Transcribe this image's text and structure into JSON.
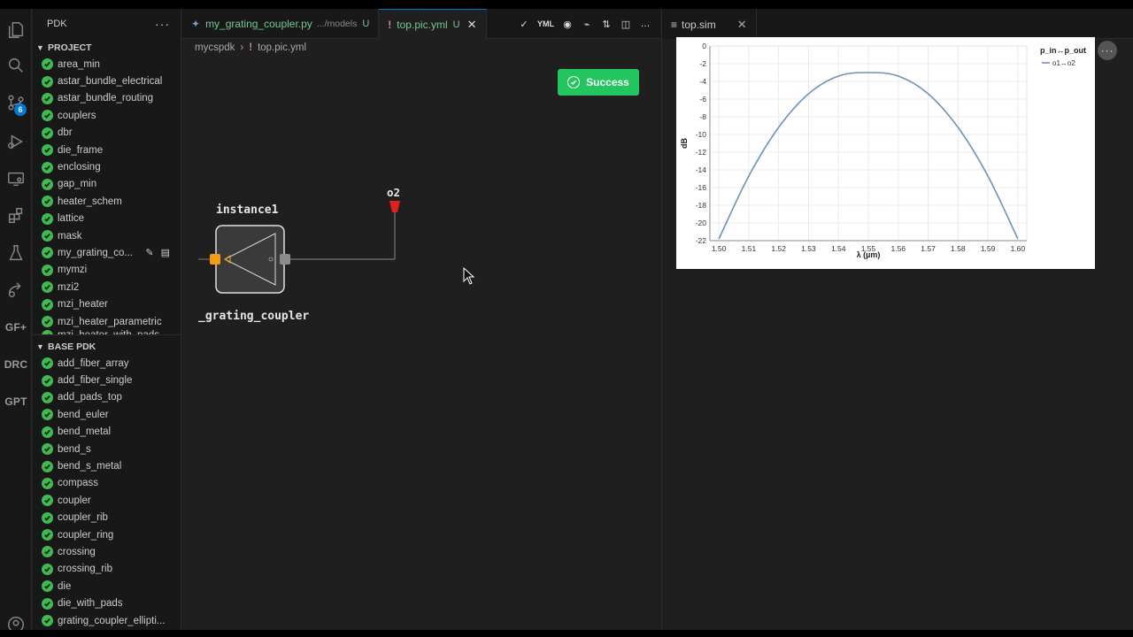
{
  "activity_bar": {
    "source_control_badge": "6",
    "gf_label": "GF+",
    "drc_label": "DRC",
    "gpt_label": "GPT"
  },
  "sidebar": {
    "title": "PDK",
    "project": {
      "title": "PROJECT",
      "items": [
        "area_min",
        "astar_bundle_electrical",
        "astar_bundle_routing",
        "couplers",
        "dbr",
        "die_frame",
        "enclosing",
        "gap_min",
        "heater_schem",
        "lattice",
        "mask",
        "my_grating_co...",
        "mymzi",
        "mzi2",
        "mzi_heater",
        "mzi_heater_parametric",
        "mzi_heater_with_pads"
      ]
    },
    "base_pdk": {
      "title": "BASE PDK",
      "items": [
        "add_fiber_array",
        "add_fiber_single",
        "add_pads_top",
        "bend_euler",
        "bend_metal",
        "bend_s",
        "bend_s_metal",
        "compass",
        "coupler",
        "coupler_rib",
        "coupler_ring",
        "crossing",
        "crossing_rib",
        "die",
        "die_with_pads",
        "grating_coupler_ellipti..."
      ]
    }
  },
  "editor1": {
    "tabs": [
      {
        "label": "my_grating_coupler.py",
        "path": ".../models",
        "status": "U"
      },
      {
        "label": "top.pic.yml",
        "status": "U"
      }
    ],
    "actions": [
      "✓",
      "YML",
      "◉",
      "⌁",
      "⇅",
      "◫",
      "…"
    ],
    "breadcrumb": [
      "mycspdk",
      "top.pic.yml"
    ],
    "success_label": "Success",
    "schematic": {
      "instance_label": "instance1",
      "component_label": "_grating_coupler",
      "port_label": "o2"
    }
  },
  "editor2": {
    "tab": "top.sim"
  },
  "colors": {
    "accent": "#0078d4",
    "success": "#22c55e",
    "check": "#3fb950",
    "curve": "#6f93b8"
  },
  "chart_data": {
    "type": "line",
    "xlabel": "λ (µm)",
    "ylabel": "dB",
    "legend_title": "p_in↔p_out",
    "legend_position": "top-right",
    "grid": true,
    "xlim": [
      1.497,
      1.603
    ],
    "ylim": [
      -22,
      0
    ],
    "xticks": [
      "1.50",
      "1.51",
      "1.52",
      "1.53",
      "1.54",
      "1.55",
      "1.56",
      "1.57",
      "1.58",
      "1.59",
      "1.60"
    ],
    "yticks": [
      "0",
      "-2",
      "-4",
      "-6",
      "-8",
      "-10",
      "-12",
      "-14",
      "-16",
      "-18",
      "-20",
      "-22"
    ],
    "series": [
      {
        "name": "o1↔o2",
        "x": [
          1.5,
          1.51,
          1.52,
          1.53,
          1.54,
          1.55,
          1.56,
          1.57,
          1.58,
          1.59,
          1.6
        ],
        "y": [
          -21.8,
          -14.7,
          -9.2,
          -5.4,
          -3.4,
          -3.0,
          -3.4,
          -5.4,
          -9.2,
          -14.7,
          -21.8
        ]
      }
    ]
  }
}
